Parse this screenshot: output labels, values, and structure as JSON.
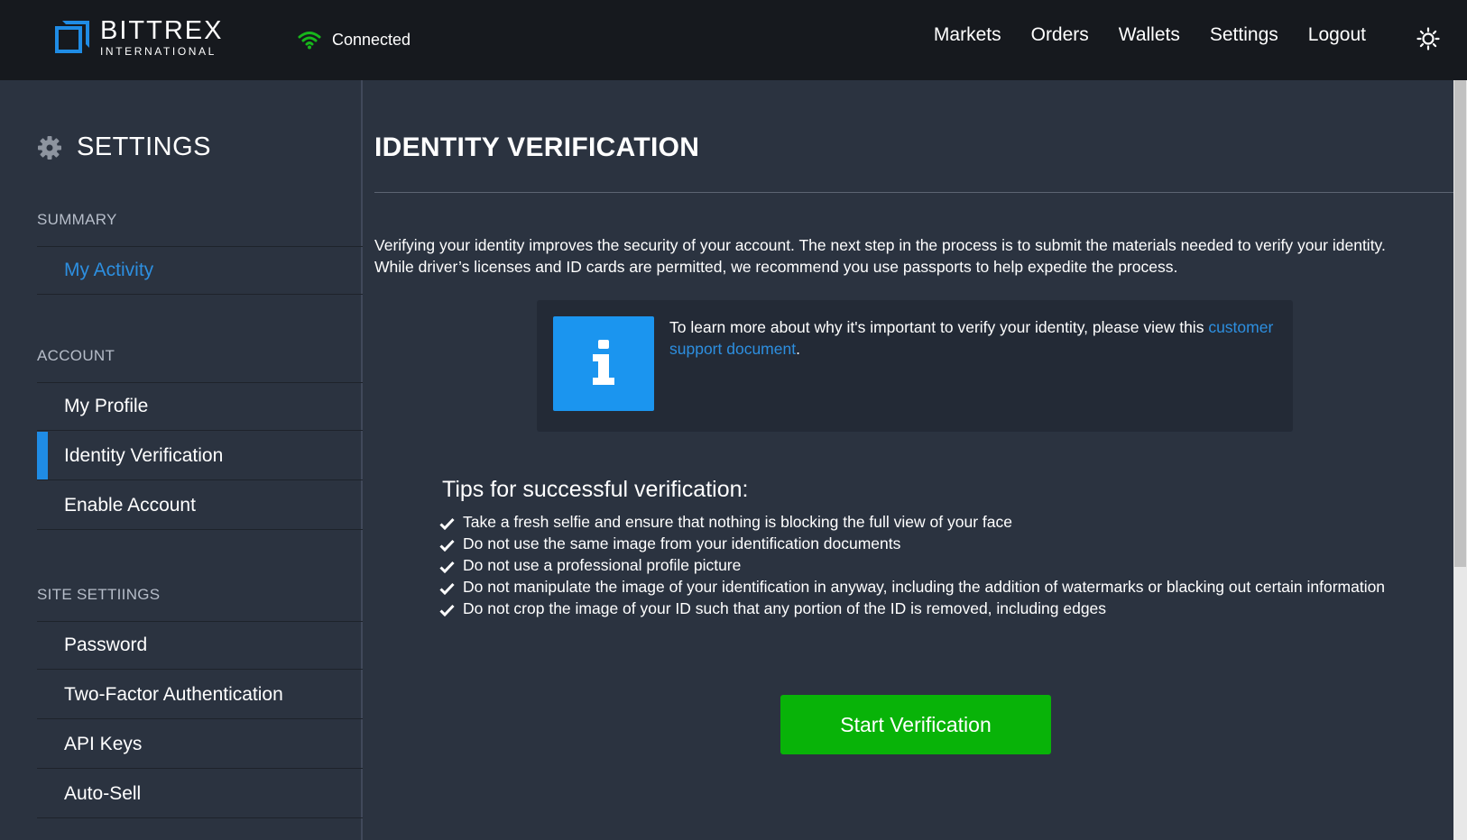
{
  "brand": {
    "name": "BITTREX",
    "sub": "INTERNATIONAL",
    "color": "#1f8ce5"
  },
  "status": {
    "label": "Connected",
    "icon": "wifi-icon",
    "color": "#17b61b"
  },
  "nav": {
    "items": [
      {
        "label": "Markets"
      },
      {
        "label": "Orders"
      },
      {
        "label": "Wallets"
      },
      {
        "label": "Settings"
      },
      {
        "label": "Logout"
      }
    ],
    "theme_icon": "sun-icon"
  },
  "sidebar": {
    "title": "SETTINGS",
    "title_icon": "gear-icon",
    "summary": {
      "heading": "SUMMARY",
      "items": [
        {
          "label": "My Activity"
        }
      ]
    },
    "account": {
      "heading": "ACCOUNT",
      "items": [
        {
          "label": "My Profile"
        },
        {
          "label": "Identity Verification"
        },
        {
          "label": "Enable Account"
        }
      ]
    },
    "site": {
      "heading": "SITE SETTIINGS",
      "items": [
        {
          "label": "Password"
        },
        {
          "label": "Two-Factor Authentication"
        },
        {
          "label": "API Keys"
        },
        {
          "label": "Auto-Sell"
        }
      ]
    }
  },
  "main": {
    "title": "IDENTITY VERIFICATION",
    "intro": "Verifying your identity improves the security of your account. The next step in the process is to submit the materials needed to verify your identity. While driver’s licenses and ID cards are permitted, we recommend you use passports to help expedite the process.",
    "info": {
      "icon": "info-icon",
      "text": "To learn more about why it's important to verify your identity, please view this",
      "link": "customer support document",
      "suffix": "."
    },
    "tips_heading": "Tips for successful verification:",
    "tips": [
      "Take a fresh selfie and ensure that nothing is blocking the full view of your face",
      "Do not use the same image from your identification documents",
      "Do not use a professional profile picture",
      "Do not manipulate the image of your identification in anyway, including the addition of watermarks or blacking out certain information",
      "Do not crop the image of your ID such that any portion of the ID is removed, including edges"
    ],
    "button": "Start Verification"
  }
}
